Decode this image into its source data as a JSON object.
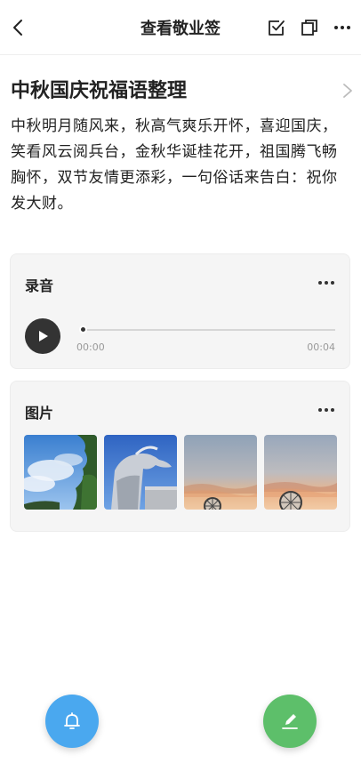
{
  "header": {
    "title": "查看敬业签",
    "icons": {
      "back": "back-chevron-icon",
      "check": "checkbox-icon",
      "copy": "copy-icon",
      "more": "more-dots-icon"
    }
  },
  "note": {
    "title": "中秋国庆祝福语整理",
    "body": "中秋明月随风来，秋高气爽乐开怀，喜迎国庆，笑看风云阅兵台，金秋华诞桂花开，祖国腾飞畅胸怀，双节友情更添彩，一句俗话来告白：祝你发大财。"
  },
  "audio": {
    "title": "录音",
    "current_time": "00:00",
    "total_time": "00:04",
    "progress": 0
  },
  "images": {
    "title": "图片",
    "count": 4
  },
  "actions": {
    "reminder_icon": "bell-icon",
    "edit_icon": "pencil-icon",
    "colors": {
      "reminder": "#4aa8ef",
      "edit": "#5dbf6a"
    }
  }
}
